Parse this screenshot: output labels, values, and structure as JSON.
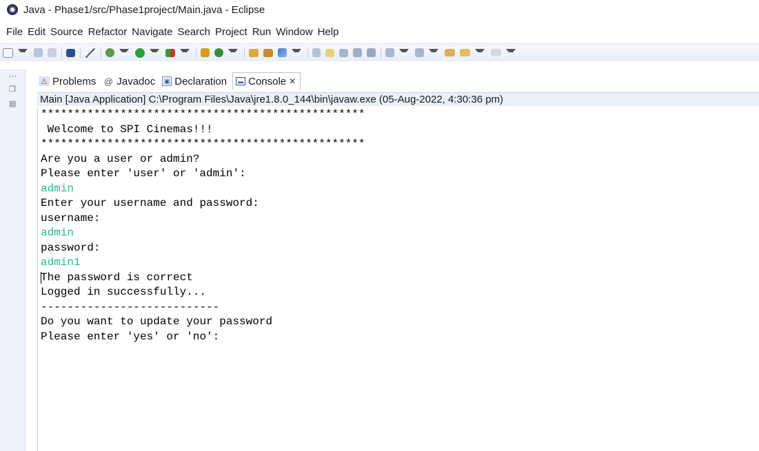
{
  "window": {
    "title": "Java - Phase1/src/Phase1project/Main.java - Eclipse"
  },
  "menu": [
    "File",
    "Edit",
    "Source",
    "Refactor",
    "Navigate",
    "Search",
    "Project",
    "Run",
    "Window",
    "Help"
  ],
  "tabs": [
    {
      "label": "Problems",
      "icon": "problems-icon",
      "active": false
    },
    {
      "label": "Javadoc",
      "icon": "javadoc-icon",
      "active": false
    },
    {
      "label": "Declaration",
      "icon": "declaration-icon",
      "active": false
    },
    {
      "label": "Console",
      "icon": "console-icon",
      "active": true,
      "close": "✕"
    }
  ],
  "console": {
    "header": "Main [Java Application] C:\\Program Files\\Java\\jre1.8.0_144\\bin\\javaw.exe (05-Aug-2022, 4:30:36 pm)",
    "lines": [
      {
        "text": "*************************************************",
        "input": false
      },
      {
        "text": " Welcome to SPI Cinemas!!!",
        "input": false
      },
      {
        "text": "*************************************************",
        "input": false
      },
      {
        "text": "Are you a user or admin?",
        "input": false
      },
      {
        "text": "Please enter 'user' or 'admin':",
        "input": false
      },
      {
        "text": "admin",
        "input": true
      },
      {
        "text": "Enter your username and password:",
        "input": false
      },
      {
        "text": "username:",
        "input": false
      },
      {
        "text": "admin",
        "input": true
      },
      {
        "text": "password:",
        "input": false
      },
      {
        "text": "admin1",
        "input": true
      },
      {
        "text": "The password is correct",
        "input": false
      },
      {
        "text": "Logged in successfully...",
        "input": false
      },
      {
        "text": "---------------------------",
        "input": false
      },
      {
        "text": "Do you want to update your password",
        "input": false
      },
      {
        "text": "Please enter 'yes' or 'no':",
        "input": false
      }
    ]
  },
  "colors": {
    "input_text": "#2ab98f",
    "toolbar_bg": "#eef2f8"
  }
}
